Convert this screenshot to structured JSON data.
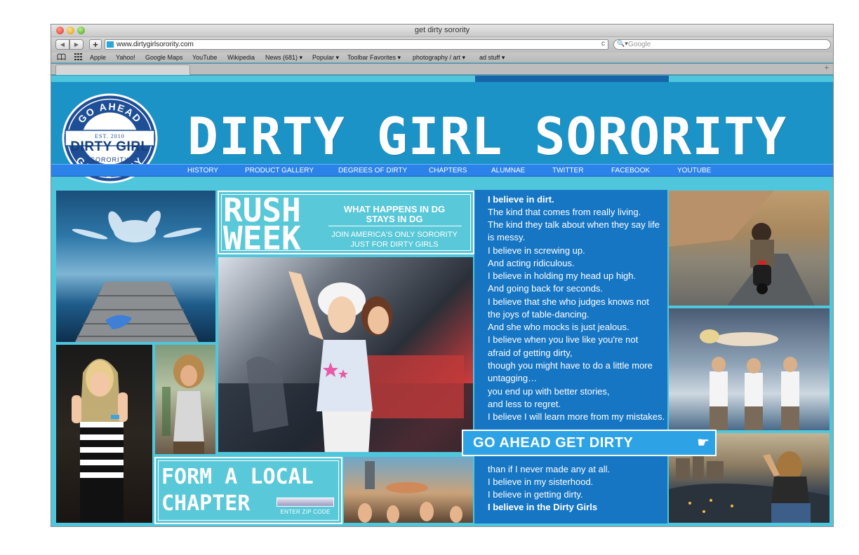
{
  "browser": {
    "window_title": "get dirty sorority",
    "url": "www.dirtygirlsorority.com",
    "search_placeholder": "Google",
    "add_label": "+",
    "reload_glyph": "c",
    "back_glyph": "◀",
    "forward_glyph": "▶",
    "search_glyph": "🔍▾",
    "tab_plus": "+",
    "bookmarks": [
      {
        "label": "Apple"
      },
      {
        "label": "Yahoo!"
      },
      {
        "label": "Google Maps"
      },
      {
        "label": "YouTube"
      },
      {
        "label": "Wikipedia"
      },
      {
        "label": "News (681) ▾"
      },
      {
        "label": "Popular ▾"
      },
      {
        "label": "Toolbar Favorites ▾"
      },
      {
        "label": "photography / art ▾"
      },
      {
        "label": "ad stuff ▾"
      }
    ]
  },
  "site": {
    "title": "DIRTY GIRL SORORITY",
    "seal": {
      "top_arc": "GO AHEAD",
      "est": "EST. 2010",
      "main": "DIRTY GIRL",
      "sub": "SORORITY",
      "bottom_arc": "GET DIRTY"
    },
    "nav": [
      {
        "label": "HISTORY"
      },
      {
        "label": "PRODUCT GALLERY"
      },
      {
        "label": "DEGREES OF DIRTY"
      },
      {
        "label": "CHAPTERS"
      },
      {
        "label": "ALUMNAE"
      },
      {
        "label": "TWITTER"
      },
      {
        "label": "FACEBOOK"
      },
      {
        "label": "YOUTUBE"
      }
    ],
    "rush": {
      "word1": "RUSH",
      "word2": "WEEK",
      "head1": "WHAT HAPPENS IN DG",
      "head2": "STAYS IN DG",
      "sub1": "JOIN AMERICA'S ONLY SORORITY",
      "sub2": "JUST FOR DIRTY GIRLS"
    },
    "creed": [
      "I believe in dirt.",
      "The kind that comes from really living.",
      "The kind they talk about when they say life",
      "is messy.",
      "I believe in screwing up.",
      "And acting ridiculous.",
      "I believe in holding my head up high.",
      "And going back for seconds.",
      "I believe that she who judges knows not",
      "the joys of table-dancing.",
      "And she who mocks is just jealous.",
      "I believe when you live like you're not",
      "afraid of getting dirty,",
      "though you might have to do a little more",
      "untagging…",
      "you end up with better stories,",
      "and less to regret.",
      "I believe I will learn more from my mistakes.",
      "than if I never made any at all.",
      "I believe in my sisterhood.",
      "I believe in getting dirty.",
      "I believe in the Dirty Girls"
    ],
    "go_banner": "GO AHEAD GET DIRTY",
    "go_hand": "☛",
    "chapter": {
      "line1": "FORM A LOCAL",
      "line2": "CHAPTER",
      "zip_label": "ENTER ZIP CODE"
    }
  },
  "colors": {
    "header_blue": "#1c93c7",
    "page_cyan": "#4fc6dc",
    "nav_blue": "#2b82e8",
    "creed_blue": "#1676c4",
    "banner_blue": "#2da3e6"
  }
}
